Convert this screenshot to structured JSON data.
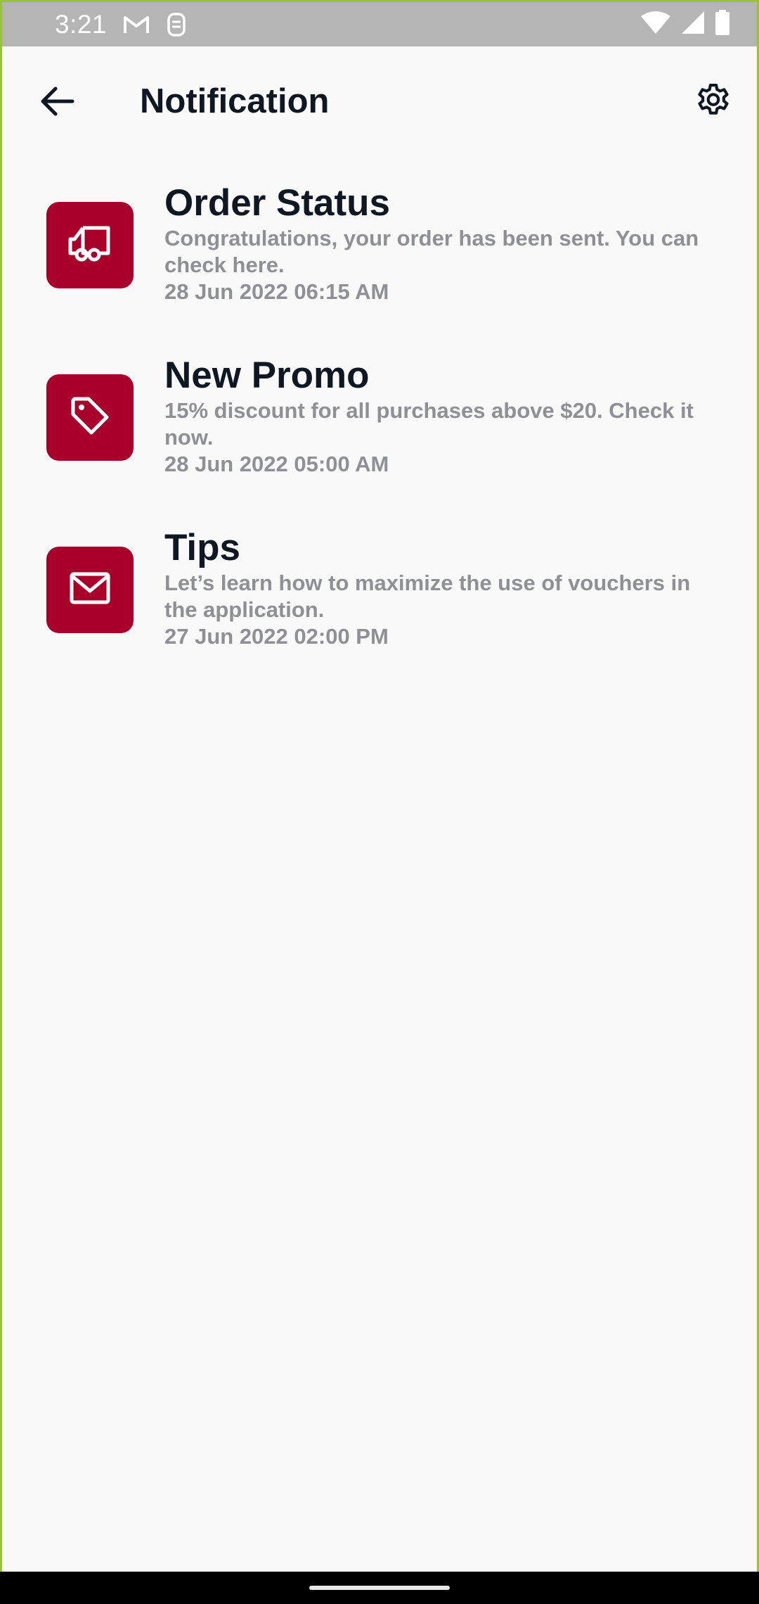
{
  "status_bar": {
    "time": "3:21",
    "icons": [
      "gmail-icon",
      "sim-card-icon",
      "wifi-icon",
      "signal-icon",
      "battery-icon"
    ]
  },
  "header": {
    "title": "Notification",
    "back_icon": "arrow-left-icon",
    "settings_icon": "gear-icon"
  },
  "colors": {
    "accent": "#a8002b",
    "title_text": "#0f1723",
    "secondary_text": "#8e9096",
    "background": "#f9f9fa"
  },
  "notifications": [
    {
      "icon": "truck-icon",
      "title": "Order Status",
      "body_line1": "Congratulations, your order has been sent. You can",
      "body_line2": "check here.",
      "time": "28 Jun 2022 06:15 AM"
    },
    {
      "icon": "tag-icon",
      "title": "New Promo",
      "body_line1": "15% discount for all purchases above $20. Check it",
      "body_line2": "now.",
      "time": "28 Jun 2022 05:00 AM"
    },
    {
      "icon": "mail-icon",
      "title": "Tips",
      "body_line1": "Let’s learn how to maximize the use of vouchers in",
      "body_line2": "the application.",
      "time": "27 Jun 2022 02:00 PM"
    }
  ]
}
